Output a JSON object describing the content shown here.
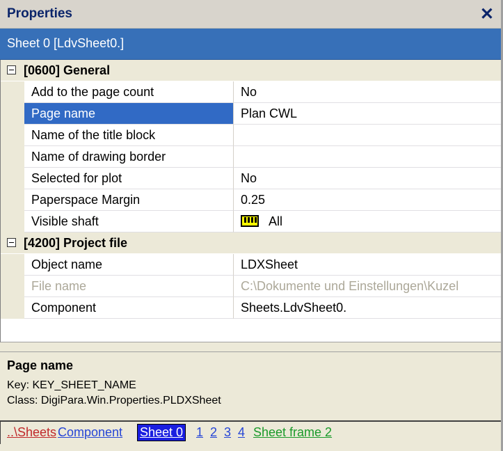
{
  "panel": {
    "title": "Properties"
  },
  "object_selector": "Sheet 0 [LdvSheet0.]",
  "categories": [
    {
      "label": "[0600] General",
      "rows": [
        {
          "name": "Add to the page count",
          "value": "No"
        },
        {
          "name": "Page name",
          "value": "Plan CWL"
        },
        {
          "name": "Name of the title block",
          "value": ""
        },
        {
          "name": "Name of drawing border",
          "value": ""
        },
        {
          "name": "Selected for plot",
          "value": "No"
        },
        {
          "name": "Paperspace Margin",
          "value": "0.25"
        },
        {
          "name": "Visible shaft",
          "value": "All",
          "icon": "shaft-icon"
        }
      ]
    },
    {
      "label": "[4200] Project file",
      "rows": [
        {
          "name": "Object name",
          "value": "LDXSheet"
        },
        {
          "name": "File name",
          "value": "C:\\Dokumente und Einstellungen\\Kuzel"
        },
        {
          "name": "Component",
          "value": "Sheets.LdvSheet0."
        }
      ]
    }
  ],
  "help": {
    "title": "Page name",
    "key_line": "Key: KEY_SHEET_NAME",
    "class_line": "Class:  DigiPara.Win.Properties.PLDXSheet"
  },
  "breadcrumb": {
    "sheets": "..\\Sheets",
    "component": "Component",
    "current": "Sheet 0",
    "pages": [
      "1",
      "2",
      "3",
      "4"
    ],
    "frame": "Sheet frame 2"
  },
  "colors": {
    "selector_bg": "#3770b8",
    "selection_bg": "#316ac5",
    "link_blue": "#2646d6",
    "link_red": "#c0282a",
    "link_green": "#1a9a2a"
  }
}
